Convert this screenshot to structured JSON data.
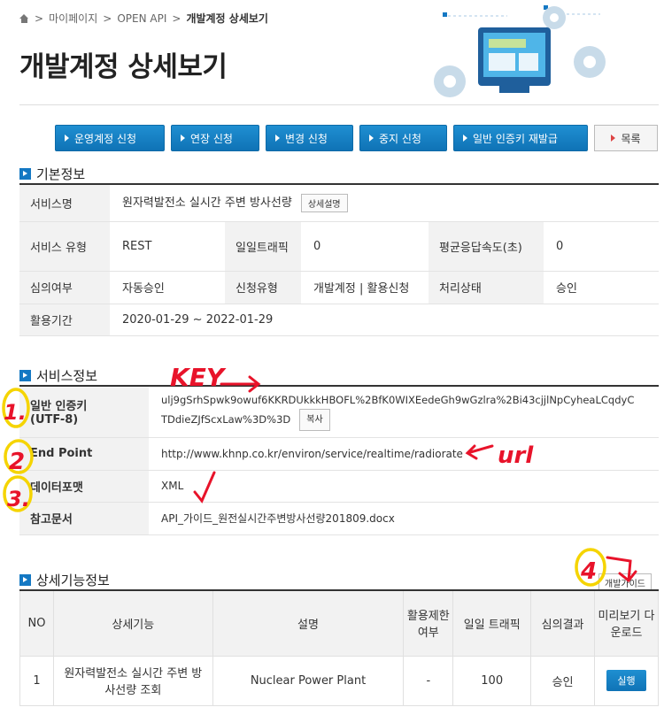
{
  "breadcrumb": {
    "items": [
      "마이페이지",
      "OPEN API"
    ],
    "current": "개발계정 상세보기",
    "sep": ">"
  },
  "page_title": "개발계정 상세보기",
  "buttons": [
    "운영계정 신청",
    "연장 신청",
    "변경 신청",
    "중지 신청",
    "일반 인증키 재발급"
  ],
  "list_button": "목록",
  "basic": {
    "title": "기본정보",
    "service_name_label": "서비스명",
    "service_name": "원자력발전소 실시간 주변 방사선량",
    "detail_btn": "상세설명",
    "service_type_label": "서비스 유형",
    "service_type": "REST",
    "daily_traffic_label": "일일트래픽",
    "daily_traffic": "0",
    "avg_speed_label": "평균응답속도(초)",
    "avg_speed": "0",
    "review_label": "심의여부",
    "review": "자동승인",
    "apply_type_label": "신청유형",
    "apply_type": "개발계정 | 활용신청",
    "status_label": "처리상태",
    "status": "승인",
    "period_label": "활용기간",
    "period": "2020-01-29 ~ 2022-01-29"
  },
  "service": {
    "title": "서비스정보",
    "key_label_1": "일반 인증키",
    "key_label_2": "(UTF-8)",
    "key_line1": "ulj9gSrhSpwk9owuf6KKRDUkkkHBOFL%2BfK0WIXEedeGh9wGzlra%2Bi43cjjlNpCyheaLCqdyC",
    "key_line2": "TDdieZJfScxLaw%3D%3D",
    "copy_btn": "복사",
    "endpoint_label": "End Point",
    "endpoint": "http://www.khnp.co.kr/environ/service/realtime/radiorate",
    "format_label": "데이터포맷",
    "format": "XML",
    "doc_label": "참고문서",
    "doc": "API_가이드_원전실시간주변방사선량201809.docx"
  },
  "detail": {
    "title": "상세기능정보",
    "guide_btn": "개발가이드",
    "headers": [
      "NO",
      "상세기능",
      "설명",
      "활용제한 여부",
      "일일 트래픽",
      "심의결과",
      "미리보기 다운로드"
    ],
    "row": {
      "no": "1",
      "func_1": "원자력발전소 실시간 주변 방",
      "func_2": "사선량 조회",
      "desc": "Nuclear Power Plant",
      "limit": "-",
      "traffic": "100",
      "result": "승인",
      "run": "실행"
    }
  },
  "annotations": {
    "key": "KEY",
    "url": "url",
    "n1": "1.",
    "n2": "2",
    "n3": "3.",
    "n4": "4"
  },
  "colors": {
    "accent": "#1478c3",
    "annotation_red": "#e8132a",
    "annotation_yellow": "#f5d400"
  }
}
